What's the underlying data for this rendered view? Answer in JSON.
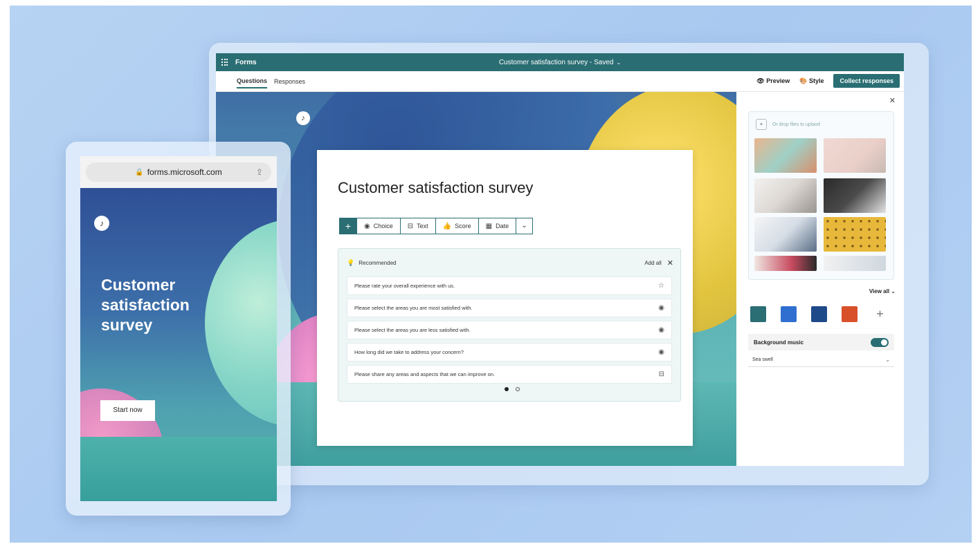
{
  "app_bar": {
    "app_name": "Forms",
    "doc_title": "Customer satisfaction survey - Saved",
    "doc_chevron": "⌄"
  },
  "tabs": [
    {
      "label": "Questions",
      "active": true
    },
    {
      "label": "Responses",
      "active": false
    }
  ],
  "actions": {
    "preview": "Preview",
    "style": "Style",
    "collect": "Collect responses"
  },
  "form": {
    "title": "Customer satisfaction survey",
    "add_symbol": "+",
    "question_types": [
      {
        "label": "Choice",
        "icon": "radio-icon"
      },
      {
        "label": "Text",
        "icon": "text-box-icon"
      },
      {
        "label": "Score",
        "icon": "thumb-icon"
      },
      {
        "label": "Date",
        "icon": "calendar-icon"
      }
    ],
    "recommended": {
      "label": "Recommended",
      "add_all": "Add all",
      "items": [
        {
          "text": "Please rate your overall experience with us.",
          "icon": "star-icon"
        },
        {
          "text": "Please select the areas you are most satisfied with.",
          "icon": "radio-icon"
        },
        {
          "text": "Please select the areas you are less satisfied with.",
          "icon": "radio-icon"
        },
        {
          "text": "How long did we take to address your concern?",
          "icon": "radio-icon"
        },
        {
          "text": "Please share any areas and aspects that we can improve on.",
          "icon": "text-box-icon"
        }
      ],
      "page": 1,
      "pages": 2
    }
  },
  "style_panel": {
    "upload_hint": "Or drop files to uplaod",
    "view_all": "View all",
    "swatch_colors": [
      "#2b6e74",
      "#2f6fd0",
      "#1f4a8a",
      "#d8502a"
    ],
    "background_music_label": "Background music",
    "background_music_on": true,
    "music_track": "Sea swell"
  },
  "phone": {
    "url": "forms.microsoft.com",
    "title": "Customer satisfaction survey",
    "start_button": "Start now"
  },
  "colors": {
    "accent": "#2a6e73",
    "background": "#b0cdf1"
  }
}
